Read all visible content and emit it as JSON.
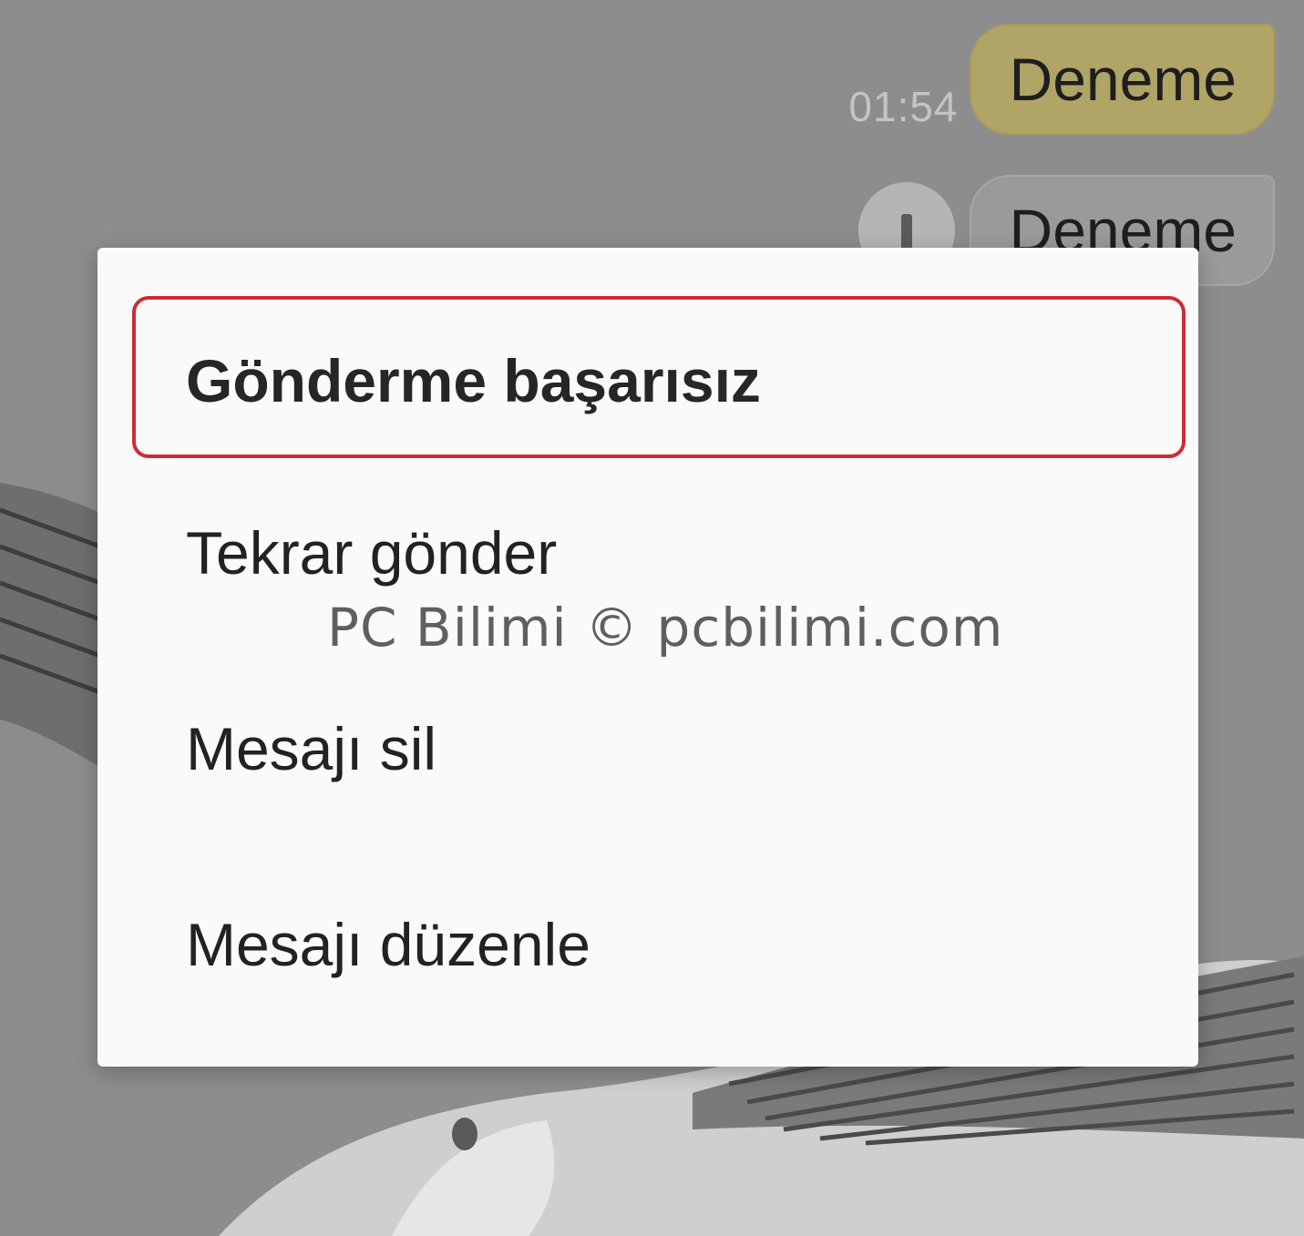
{
  "chat": {
    "messages": [
      {
        "time": "01:54",
        "text": "Deneme",
        "status": "sent",
        "bubble_color": "#b0a466"
      },
      {
        "text": "Deneme",
        "status": "failed",
        "bubble_color": "#9a9a9a",
        "status_icon": "exclamation-icon"
      }
    ]
  },
  "dialog": {
    "title": "Gönderme başarısız",
    "highlight_color": "#cf2b36",
    "items": [
      {
        "label": "Tekrar gönder"
      },
      {
        "label": "Mesajı sil"
      },
      {
        "label": "Mesajı düzenle"
      }
    ]
  },
  "watermark": "PC Bilimi © pcbilimi.com"
}
